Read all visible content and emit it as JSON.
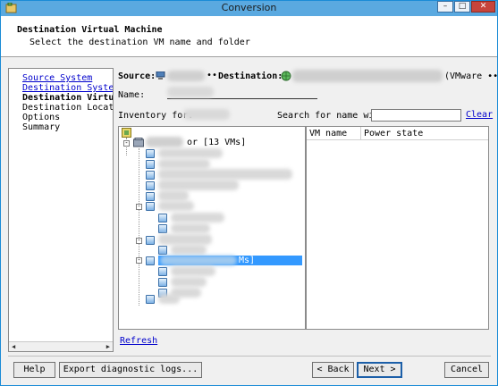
{
  "window": {
    "title": "Conversion"
  },
  "header": {
    "title": "Destination Virtual Machine",
    "subtitle": "Select the destination VM name and folder"
  },
  "nav": {
    "items": [
      {
        "label": "Source System",
        "state": "link"
      },
      {
        "label": "Destination System",
        "state": "link"
      },
      {
        "label": "Destination Virtua",
        "state": "current"
      },
      {
        "label": "Destination Location",
        "state": "plain"
      },
      {
        "label": "Options",
        "state": "plain"
      },
      {
        "label": "Summary",
        "state": "plain"
      }
    ]
  },
  "main": {
    "source_label": "Source:",
    "source_dots": "••",
    "destination_label": "Destination:",
    "destination_suffix": "(VMware ••",
    "name_label": "Name:",
    "inventory_label": "Inventory for:",
    "search_label": "Search for name with:",
    "search_value": "",
    "clear_label": "Clear",
    "tree_root_suffix": "or [13 VMs]",
    "tree_selected_suffix": "Ms]",
    "list_columns": [
      "VM name",
      "Power state"
    ],
    "refresh_label": "Refresh"
  },
  "footer": {
    "help_label": "Help",
    "export_label": "Export diagnostic logs...",
    "back_label": "< Back",
    "next_label": "Next >",
    "cancel_label": "Cancel"
  },
  "colors": {
    "title_bar": "#5aa9e0",
    "selection": "#3399ff",
    "link": "#0000cc",
    "close_button": "#c7443b"
  }
}
